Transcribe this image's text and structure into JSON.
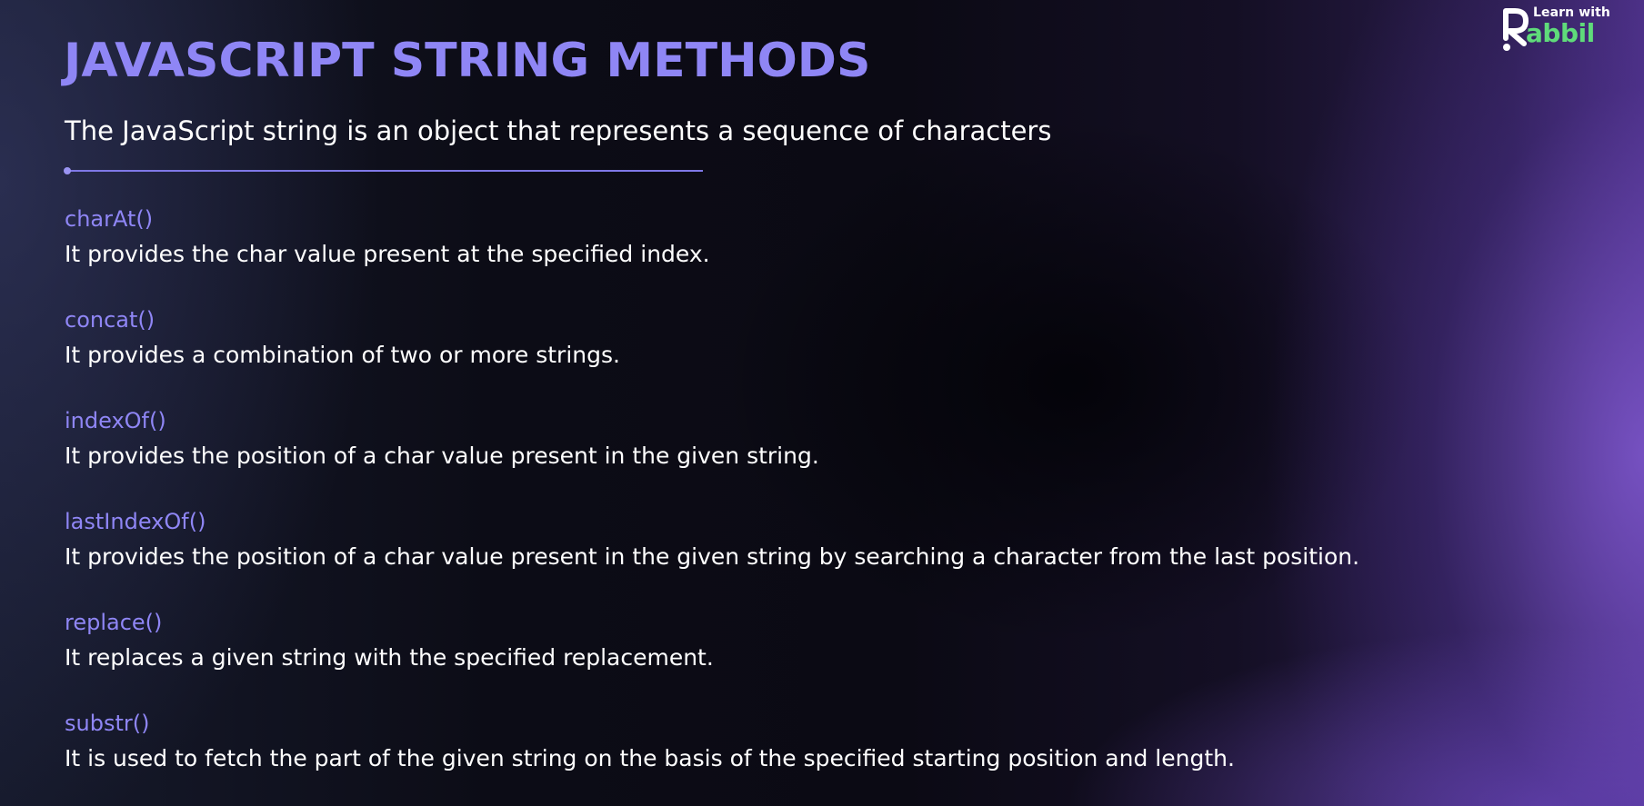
{
  "logo": {
    "tagline": "Learn with",
    "brand_rest": "abbil",
    "brand_color": "#5fdb7a"
  },
  "title": "JAVASCRIPT STRING METHODS",
  "subtitle": "The JavaScript string is an object that represents a sequence of characters",
  "methods": [
    {
      "name": "charAt()",
      "description": "It provides the char value present at the specified index."
    },
    {
      "name": "concat()",
      "description": "It provides a combination of two or more strings."
    },
    {
      "name": "indexOf()",
      "description": "It provides the position of a char value present in the given string."
    },
    {
      "name": "lastIndexOf()",
      "description": "It provides the position of a char value present in the given string by searching a character from the last position."
    },
    {
      "name": "replace()",
      "description": "It replaces a given string with the specified replacement."
    },
    {
      "name": "substr()",
      "description": "It is used to fetch the part of the given string on the basis of the specified starting position and length."
    }
  ],
  "colors": {
    "accent": "#8f86f5",
    "text": "#ffffff",
    "divider": "#7f78e6"
  }
}
